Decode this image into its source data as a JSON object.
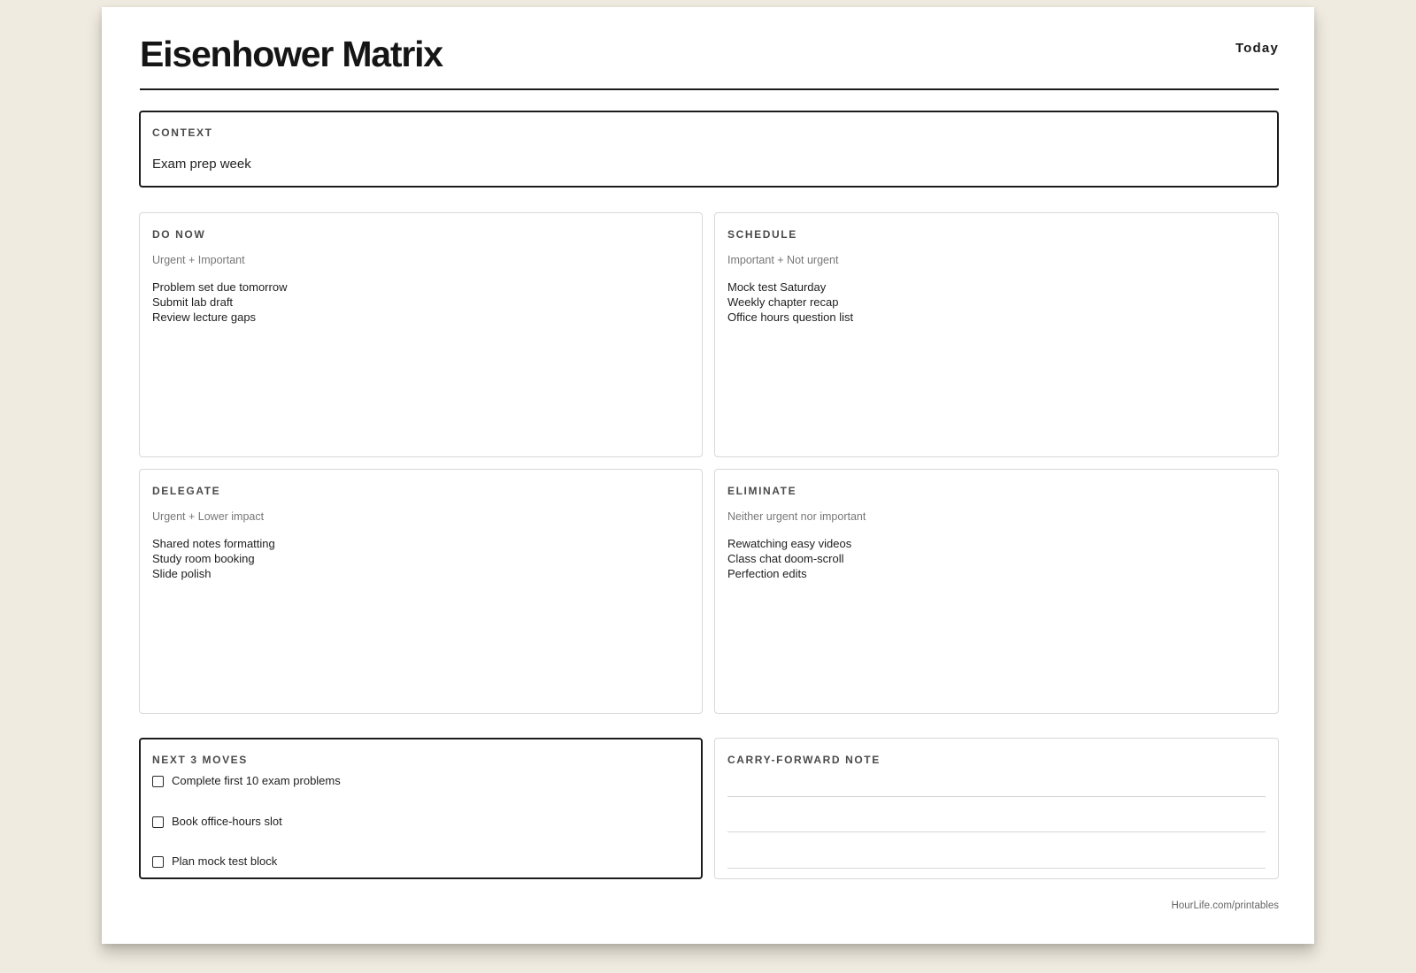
{
  "header": {
    "title": "Eisenhower Matrix",
    "date_label": "Today"
  },
  "context": {
    "heading": "CONTEXT",
    "value": "Exam prep week"
  },
  "quadrants": [
    {
      "heading": "DO NOW",
      "subtitle": "Urgent + Important",
      "items": [
        "Problem set due tomorrow",
        "Submit lab draft",
        "Review lecture gaps"
      ]
    },
    {
      "heading": "SCHEDULE",
      "subtitle": "Important + Not urgent",
      "items": [
        "Mock test Saturday",
        "Weekly chapter recap",
        "Office hours question list"
      ]
    },
    {
      "heading": "DELEGATE",
      "subtitle": "Urgent + Lower impact",
      "items": [
        "Shared notes formatting",
        "Study room booking",
        "Slide polish"
      ]
    },
    {
      "heading": "ELIMINATE",
      "subtitle": "Neither urgent nor important",
      "items": [
        "Rewatching easy videos",
        "Class chat doom-scroll",
        "Perfection edits"
      ]
    }
  ],
  "next_moves": {
    "heading": "NEXT 3 MOVES",
    "items": [
      {
        "label": "Complete first 10 exam problems",
        "checked": false
      },
      {
        "label": "Book office-hours slot",
        "checked": false
      },
      {
        "label": "Plan mock test block",
        "checked": false
      }
    ]
  },
  "carry_forward": {
    "heading": "CARRY-FORWARD NOTE"
  },
  "footer": {
    "text": "HourLife.com/printables"
  },
  "colors": {
    "background": "#efebe0",
    "paper": "#ffffff",
    "ink": "#1a1a1a",
    "muted": "#777777",
    "border": "#d8d8d8"
  }
}
